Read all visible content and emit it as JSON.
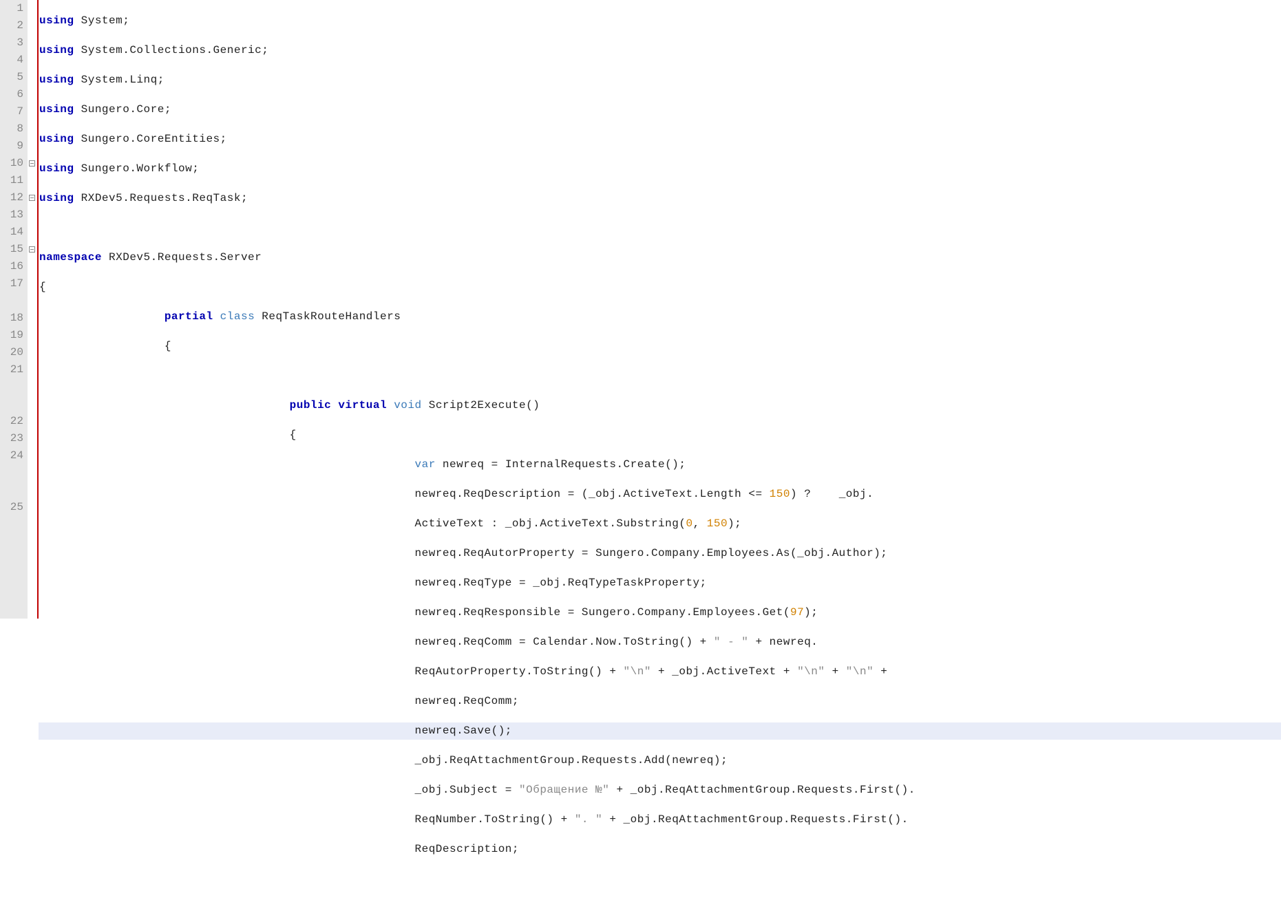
{
  "lines": {
    "l1": {
      "num": "1"
    },
    "l2": {
      "num": "2"
    },
    "l3": {
      "num": "3"
    },
    "l4": {
      "num": "4"
    },
    "l5": {
      "num": "5"
    },
    "l6": {
      "num": "6"
    },
    "l7": {
      "num": "7"
    },
    "l8": {
      "num": "8"
    },
    "l9": {
      "num": "9"
    },
    "l10": {
      "num": "10"
    },
    "l11": {
      "num": "11"
    },
    "l12": {
      "num": "12"
    },
    "l13": {
      "num": "13"
    },
    "l14": {
      "num": "14"
    },
    "l15": {
      "num": "15"
    },
    "l16": {
      "num": "16"
    },
    "l17": {
      "num": "17"
    },
    "l18": {
      "num": "18"
    },
    "l19": {
      "num": "19"
    },
    "l20": {
      "num": "20"
    },
    "l21": {
      "num": "21"
    },
    "l22": {
      "num": "22"
    },
    "l23": {
      "num": "23"
    },
    "l24": {
      "num": "24"
    },
    "l25": {
      "num": "25"
    }
  },
  "tokens": {
    "using": "using",
    "namespace": "namespace",
    "partial": "partial",
    "class": "class",
    "public": "public",
    "virtual": "virtual",
    "void": "void",
    "var": "var",
    "System": " System;",
    "SystemCollectionsGeneric": " System.Collections.Generic;",
    "SystemLinq": " System.Linq;",
    "SungeroCore": " Sungero.Core;",
    "SungeroCoreEntities": " Sungero.CoreEntities;",
    "SungeroWorkflow": " Sungero.Workflow;",
    "RXDev5RequestsReqTask": " RXDev5.Requests.ReqTask;",
    "ns": " RXDev5.Requests.Server",
    "classname": " ReqTaskRouteHandlers",
    "method": " Script2Execute()",
    "brace_open": "{",
    "brace_close": "}",
    "l16_a": " newreq = InternalRequests.Create();",
    "l17_a": "newreq.ReqDescription = (_obj.ActiveText.Length <= ",
    "n150": "150",
    "l17_b": ") ?    _obj.",
    "l17w_a": "ActiveText : _obj.ActiveText.Substring(",
    "n0": "0",
    "comma": ", ",
    "l17w_b": ");",
    "l18_a": "newreq.ReqAutorProperty = Sungero.Company.Employees.As(_obj.Author);",
    "l19_a": "newreq.ReqType = _obj.ReqTypeTaskProperty;",
    "l20_a": "newreq.ReqResponsible = Sungero.Company.Employees.Get(",
    "n97": "97",
    "l20_b": ");",
    "l21_a": "newreq.ReqComm = Calendar.Now.ToString() + ",
    "s_dash": "\" - \"",
    "l21_b": " + newreq.",
    "l21w_a": "ReqAutorProperty.ToString() + ",
    "s_nl": "\"\\n\"",
    "l21w_b": " + _obj.ActiveText + ",
    "plus": " + ",
    "l21w2": "newreq.ReqComm;",
    "l22_a": "newreq.Save();",
    "l23_a": "_obj.ReqAttachmentGroup.Requests.Add(newreq);",
    "l24_a": "_obj.Subject = ",
    "s_obr": "\"Обращение №\"",
    "l24_b": " + _obj.ReqAttachmentGroup.Requests.First().",
    "l24w_a": "ReqNumber.ToString() + ",
    "s_dotsp": "\". \"",
    "l24w_b": " + _obj.ReqAttachmentGroup.Requests.First().",
    "l24w2": "ReqDescription;"
  },
  "indent": {
    "col1": "                  ",
    "col2": "                                    ",
    "col3": "                                                      "
  }
}
